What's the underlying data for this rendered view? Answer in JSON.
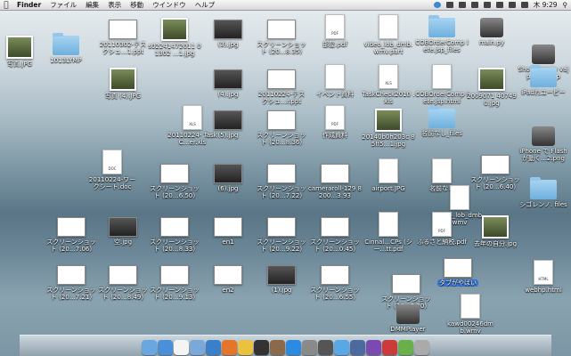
{
  "menubar": {
    "apple": "",
    "app": "Finder",
    "items": [
      "ファイル",
      "編集",
      "表示",
      "移動",
      "ウインドウ",
      "ヘルプ"
    ],
    "clock": "木 9:29"
  },
  "desktop": {
    "icons": [
      {
        "label": "写真.JPG",
        "kind": "photo"
      },
      {
        "label": "1013LYMP",
        "kind": "folder"
      },
      {
        "label": "20110302-テス クシュ…1.ppt",
        "kind": "shot"
      },
      {
        "label": "s02241472011 01302 …1.jpg",
        "kind": "photo"
      },
      {
        "label": "(3).jpg",
        "kind": "shot"
      },
      {
        "label": "スクリーンショット (20…8.35)",
        "kind": "shot"
      },
      {
        "label": "部屋.pdf",
        "kind": "file",
        "tag": "PDF"
      },
      {
        "label": "video_lob_dmb. wmv.part",
        "kind": "file"
      },
      {
        "label": "COBOrderComp lete.jsp_files",
        "kind": "folder"
      },
      {
        "label": "main.py",
        "kind": "app"
      },
      {
        "label": "ShortNote/Ja vajp120_9.zip",
        "kind": "app"
      },
      {
        "label": "写真 (4).JPG",
        "kind": "photo"
      },
      {
        "label": "(4).jpg",
        "kind": "shot"
      },
      {
        "label": "20110224-テス クシュ…r.ppt",
        "kind": "shot"
      },
      {
        "label": "イベント資料",
        "kind": "file"
      },
      {
        "label": "TaskCheck2010 .xls",
        "kind": "file",
        "tag": "XLS"
      },
      {
        "label": "COBOrderComp lete.jsp.html",
        "kind": "file"
      },
      {
        "label": "2009071 40749 0.jpg",
        "kind": "photo"
      },
      {
        "label": "iPadれユーピー",
        "kind": "folder"
      },
      {
        "label": "20110224- TaskC…er.xls",
        "kind": "file",
        "tag": "XLS"
      },
      {
        "label": "(5).jpg",
        "kind": "shot"
      },
      {
        "label": "スクリーンショット (20…8.36)",
        "kind": "shot"
      },
      {
        "label": "作成資料",
        "kind": "file",
        "tag": "PDF"
      },
      {
        "label": "20140b0h203c 85ff5…1.jpg",
        "kind": "photo"
      },
      {
        "label": "名前なし_files",
        "kind": "folder"
      },
      {
        "label": "iPhone で Flash が動く…2.png",
        "kind": "app"
      },
      {
        "label": "20110224-ワー クシート.doc",
        "kind": "file",
        "tag": "DOC"
      },
      {
        "label": "スクリーンショット (20…6.50)",
        "kind": "shot"
      },
      {
        "label": "(6).jpg",
        "kind": "shot"
      },
      {
        "label": "スクリーンショット (20…7.22)",
        "kind": "shot"
      },
      {
        "label": "cameraroll-129 8200…3.93",
        "kind": "shot"
      },
      {
        "label": "airport.JPG",
        "kind": "file"
      },
      {
        "label": "名前なし",
        "kind": "file"
      },
      {
        "label": "スクリーンショット (20…6.40)",
        "kind": "shot"
      },
      {
        "label": "シゴレンノ. files",
        "kind": "folder"
      },
      {
        "label": "video_lob_dmb. wmv",
        "kind": "file"
      },
      {
        "label": "スクリーンショット (20…7.06)",
        "kind": "shot"
      },
      {
        "label": "空.jpg",
        "kind": "shot"
      },
      {
        "label": "スクリーンショット (20…8.33)",
        "kind": "shot"
      },
      {
        "label": "en1",
        "kind": "shot"
      },
      {
        "label": "スクリーンショット (20…9.22)",
        "kind": "shot"
      },
      {
        "label": "スクリーンショット (20…0.45)",
        "kind": "shot"
      },
      {
        "label": "Cinnal…CPs (シー…tt.pdf",
        "kind": "file"
      },
      {
        "label": "ふるさと納税.pdf",
        "kind": "file",
        "tag": "PDF"
      },
      {
        "label": "去年の自分.jpg",
        "kind": "photo"
      },
      {
        "label": "スクリーンショット (20…7.21)",
        "kind": "shot"
      },
      {
        "label": "スクリーンショット (20…8.49)",
        "kind": "shot"
      },
      {
        "label": "スクリーンショット (20…9.13)",
        "kind": "shot"
      },
      {
        "label": "en2",
        "kind": "shot"
      },
      {
        "label": "(1).jpg",
        "kind": "shot"
      },
      {
        "label": "スクリーンショット (20…6.55)",
        "kind": "shot"
      },
      {
        "label": "スクリーンショット (20…2.20)",
        "kind": "shot"
      },
      {
        "label": "タブがやばい",
        "kind": "shot",
        "selected": true
      },
      {
        "label": "webhp.html",
        "kind": "file",
        "tag": "HTML"
      },
      {
        "label": "DMMPlayer",
        "kind": "app"
      },
      {
        "label": "kawd00246dm b.wmv",
        "kind": "file"
      }
    ]
  },
  "dock": {
    "items": [
      "finder-icon",
      "safari-icon",
      "calendar-icon",
      "mail-icon",
      "itunes-icon",
      "firefox-icon",
      "chrome-icon",
      "terminal-icon",
      "photo-icon",
      "appstore-icon",
      "sysprefs-icon",
      "camera-icon",
      "twitter-icon",
      "dashboard-icon",
      "itunes-store-icon",
      "preview-icon",
      "evernote-icon",
      "trash-icon"
    ],
    "colors": [
      "#6aa6e0",
      "#4a90d9",
      "#f4f4f4",
      "#7aa8d8",
      "#3a7fc9",
      "#e4752b",
      "#e9c33f",
      "#333333",
      "#8a6a4a",
      "#2a8be0",
      "#8a8a8a",
      "#555555",
      "#59a8e6",
      "#4a6aa0",
      "#7a4ab0",
      "#cc3a3a",
      "#6ab04a",
      "#aaaaaa"
    ]
  }
}
